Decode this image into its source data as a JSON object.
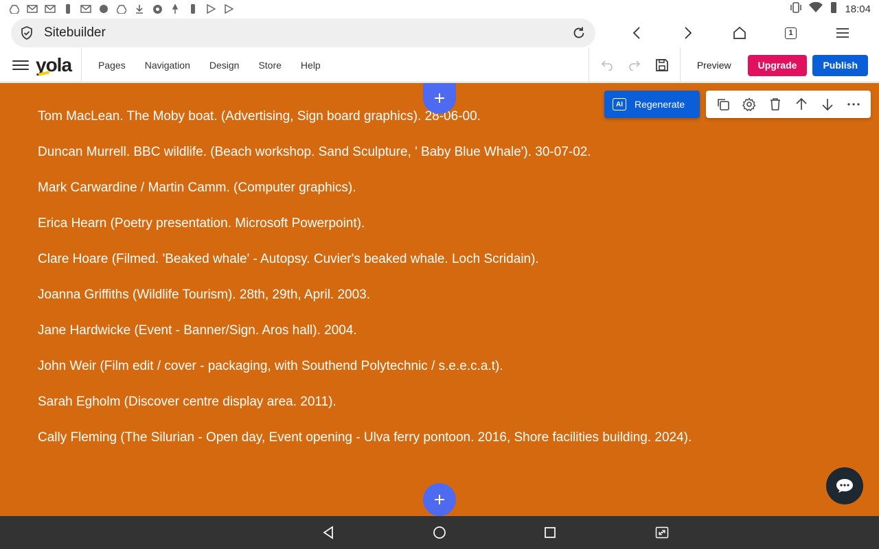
{
  "status_bar": {
    "time": "18:04",
    "notification_icons": [
      "drive-icon",
      "gmail-icon",
      "gmail-icon",
      "torch-icon",
      "gmail-icon",
      "android-icon",
      "drive-icon",
      "download-icon",
      "chrome-icon",
      "pin-icon",
      "torch-icon",
      "play-icon",
      "play-icon"
    ],
    "right_icons": [
      "vibrate-icon",
      "wifi-icon",
      "battery-icon"
    ]
  },
  "browser": {
    "url": "Sitebuilder",
    "tab_count": "1"
  },
  "app_header": {
    "logo": "yola",
    "menu": [
      "Pages",
      "Navigation",
      "Design",
      "Store",
      "Help"
    ],
    "preview_label": "Preview",
    "upgrade_label": "Upgrade",
    "publish_label": "Publish",
    "colors": {
      "upgrade": "#e0115f",
      "publish": "#0a5ed7"
    }
  },
  "editor": {
    "regenerate_label": "Regenerate",
    "ai_badge": "AI",
    "background_color": "#d4690f",
    "lines": [
      "Tom MacLean. The Moby boat. (Advertising, Sign board graphics). 28-06-00.",
      "Duncan Murrell.  BBC wildlife. (Beach workshop. Sand Sculpture, ' Baby Blue Whale'). 30-07-02.",
      "Mark Carwardine / Martin Camm. (Computer graphics).",
      "Erica Hearn  (Poetry presentation. Microsoft Powerpoint).",
      "Clare Hoare  (Filmed. 'Beaked whale' - Autopsy. Cuvier's beaked whale. Loch Scridain).",
      "Joanna Griffiths  (Wildlife Tourism). 28th, 29th, April. 2003.",
      "Jane Hardwicke  (Event - Banner/Sign. Aros hall). 2004.",
      "John Weir (Film edit / cover - packaging, with Southend Polytechnic / s.e.e.c.a.t).",
      "Sarah Egholm  (Discover centre display area. 2011).",
      "Cally Fleming  (The Silurian - Open day, Event opening - Ulva ferry pontoon. 2016, Shore facilities building. 2024)."
    ]
  }
}
